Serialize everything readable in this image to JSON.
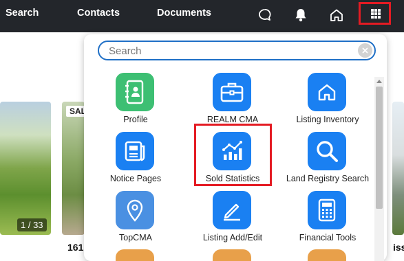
{
  "nav": {
    "search": "Search",
    "contacts": "Contacts",
    "documents": "Documents"
  },
  "top_icons": [
    "chat-icon",
    "bell-icon",
    "home-icon",
    "apps-grid-icon"
  ],
  "background": {
    "counter": "1 / 33",
    "badge": "SAL",
    "address_left": "161",
    "address_right": "iss"
  },
  "launcher": {
    "search_placeholder": "Search",
    "apps": [
      {
        "label": "Profile",
        "icon": "contact-book-icon",
        "color": "#3dbf73"
      },
      {
        "label": "REALM CMA",
        "icon": "briefcase-icon",
        "color": "#1a80f2"
      },
      {
        "label": "Listing Inventory",
        "icon": "house-icon",
        "color": "#1a80f2"
      },
      {
        "label": "Notice Pages",
        "icon": "newspaper-icon",
        "color": "#1a80f2"
      },
      {
        "label": "Sold Statistics",
        "icon": "bar-chart-icon",
        "color": "#1a80f2"
      },
      {
        "label": "Land Registry Search",
        "icon": "magnifier-icon",
        "color": "#1a80f2"
      },
      {
        "label": "TopCMA",
        "icon": "map-pin-icon",
        "color": "#4a90e2"
      },
      {
        "label": "Listing Add/Edit",
        "icon": "pencil-icon",
        "color": "#1a80f2"
      },
      {
        "label": "Financial Tools",
        "icon": "calculator-icon",
        "color": "#1a80f2"
      }
    ]
  },
  "colors": {
    "topbar": "#23262b",
    "accent_blue": "#1a80f2",
    "highlight_red": "#e41b23"
  }
}
